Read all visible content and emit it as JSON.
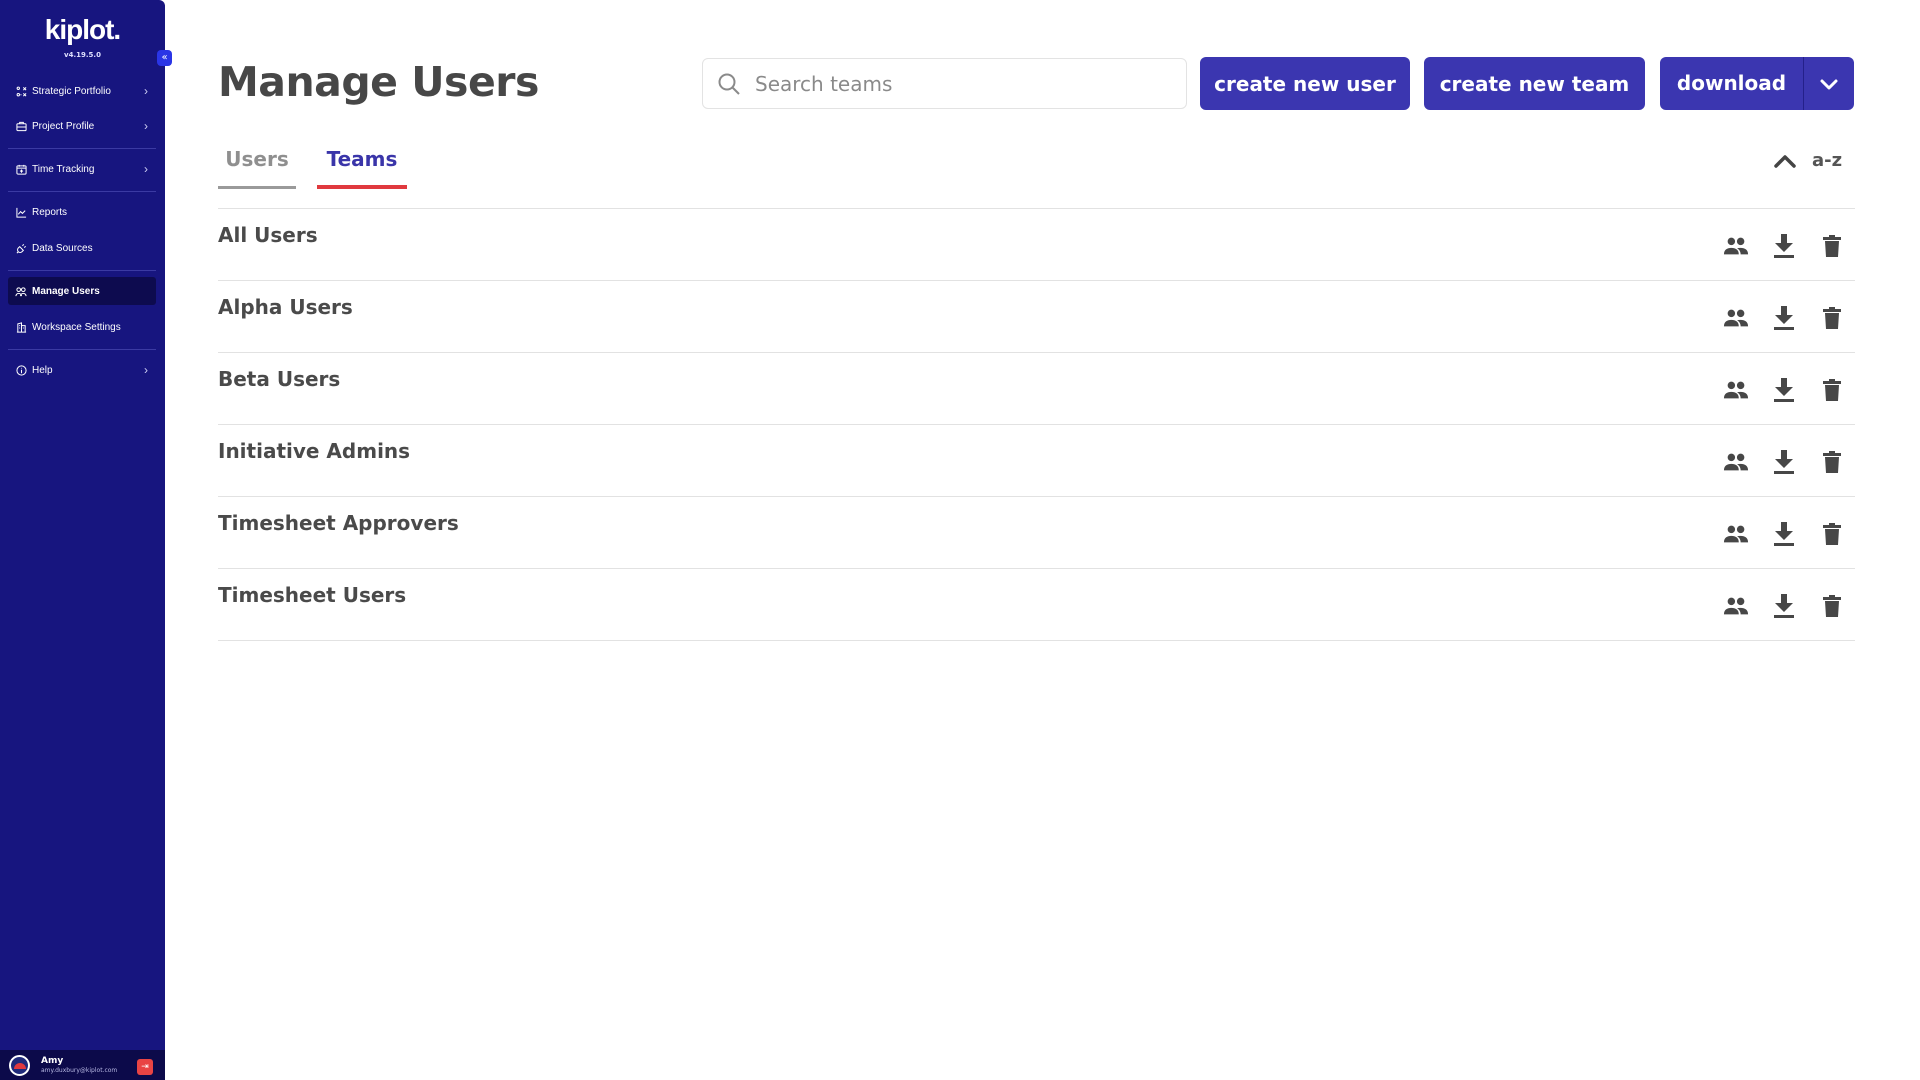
{
  "sidebar": {
    "logo": "kiplot.",
    "version": "v4.19.5.0",
    "items": [
      {
        "label": "Strategic Portfolio",
        "icon": "strategy-icon",
        "has_chevron": true
      },
      {
        "label": "Project Profile",
        "icon": "briefcase-icon",
        "has_chevron": true
      },
      {
        "label": "Time Tracking",
        "icon": "calendar-icon",
        "has_chevron": true
      },
      {
        "label": "Reports",
        "icon": "chart-line-icon",
        "has_chevron": false
      },
      {
        "label": "Data Sources",
        "icon": "plug-icon",
        "has_chevron": false
      },
      {
        "label": "Manage Users",
        "icon": "users-icon",
        "has_chevron": false,
        "active": true
      },
      {
        "label": "Workspace Settings",
        "icon": "building-icon",
        "has_chevron": false
      },
      {
        "label": "Help",
        "icon": "info-icon",
        "has_chevron": true
      }
    ],
    "user": {
      "name": "Amy",
      "email": "amy.duxbury@kiplot.com"
    }
  },
  "header": {
    "title": "Manage Users",
    "search_placeholder": "Search teams",
    "search_value": "",
    "buttons": {
      "create_user": "create new user",
      "create_team": "create new team",
      "download": "download"
    }
  },
  "tabs": [
    {
      "label": "Users",
      "active": false
    },
    {
      "label": "Teams",
      "active": true
    }
  ],
  "sort": {
    "label": "a-z",
    "direction": "ascending"
  },
  "teams": [
    {
      "name": "All Users"
    },
    {
      "name": "Alpha Users"
    },
    {
      "name": "Beta Users"
    },
    {
      "name": "Initiative Admins"
    },
    {
      "name": "Timesheet Approvers"
    },
    {
      "name": "Timesheet Users"
    }
  ],
  "colors": {
    "sidebar_bg": "#17157f",
    "primary": "#3b36b0",
    "active_tab_underline": "#e0393e",
    "logout": "#e94444"
  }
}
